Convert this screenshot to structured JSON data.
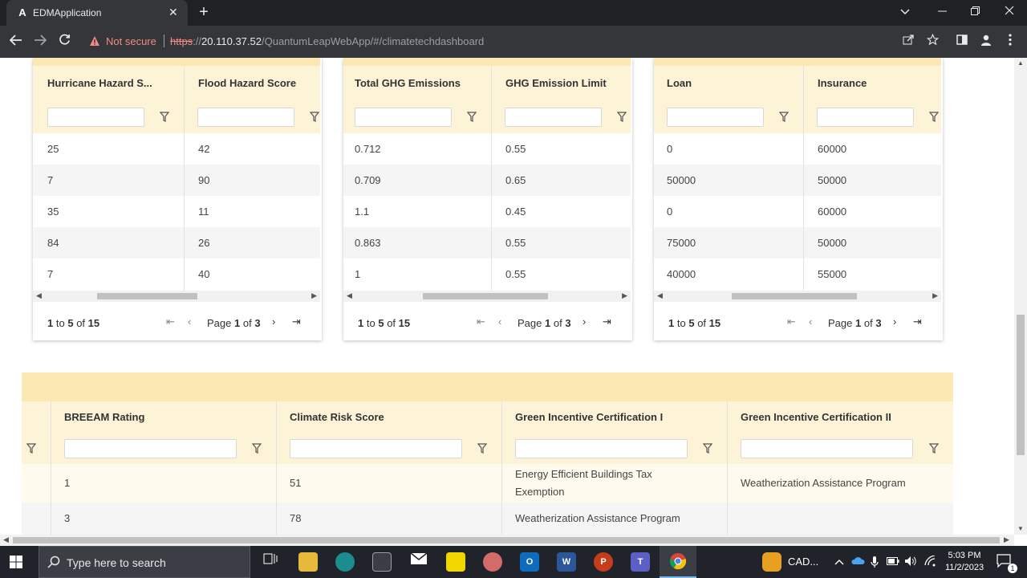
{
  "browser": {
    "tab_title": "EDMApplication",
    "tab_favicon": "A",
    "tab_close": "✕",
    "new_tab": "+",
    "security_label": "Not secure",
    "url_scheme": "https",
    "url_host": "20.110.37.52",
    "url_path": "/QuantumLeapWebApp/#/climatetechdashboard"
  },
  "grids": [
    {
      "columns": [
        "Hurricane Hazard S...",
        "Flood Hazard Score"
      ],
      "rows": [
        [
          "25",
          "42"
        ],
        [
          "7",
          "90"
        ],
        [
          "35",
          "11"
        ],
        [
          "84",
          "26"
        ],
        [
          "7",
          "40"
        ]
      ],
      "pager": {
        "from": "1",
        "to": "5",
        "total": "15",
        "page": "1",
        "pages": "3"
      }
    },
    {
      "columns": [
        "Total GHG Emissions",
        "GHG Emission Limit"
      ],
      "rows": [
        [
          "0.712",
          "0.55"
        ],
        [
          "0.709",
          "0.65"
        ],
        [
          "1.1",
          "0.45"
        ],
        [
          "0.863",
          "0.55"
        ],
        [
          "1",
          "0.55"
        ]
      ],
      "pager": {
        "from": "1",
        "to": "5",
        "total": "15",
        "page": "1",
        "pages": "3"
      }
    },
    {
      "columns": [
        "Loan",
        "Insurance"
      ],
      "rows": [
        [
          "0",
          "60000"
        ],
        [
          "50000",
          "50000"
        ],
        [
          "0",
          "60000"
        ],
        [
          "75000",
          "50000"
        ],
        [
          "40000",
          "55000"
        ]
      ],
      "pager": {
        "from": "1",
        "to": "5",
        "total": "15",
        "page": "1",
        "pages": "3"
      }
    }
  ],
  "pager_words": {
    "to": "to",
    "of": "of",
    "page": "Page"
  },
  "wide_grid": {
    "columns": [
      "BREEAM Rating",
      "Climate Risk Score",
      "Green Incentive Certification I",
      "Green Incentive Certification II"
    ],
    "rows": [
      [
        "1",
        "51",
        "Energy Efficient Buildings Tax Exemption",
        "Weatherization Assistance Program"
      ],
      [
        "3",
        "78",
        "Weatherization Assistance Program",
        ""
      ]
    ]
  },
  "taskbar": {
    "search_placeholder": "Type here to search",
    "tray_app_label": "CAD...",
    "time": "5:03 PM",
    "date": "11/2/2023",
    "notification_count": "1"
  },
  "colors": {
    "header_band": "#fce8b2",
    "header_bg": "#fdf3d6",
    "alt_row": "#f5f5f5",
    "warning": "#f28b82"
  }
}
